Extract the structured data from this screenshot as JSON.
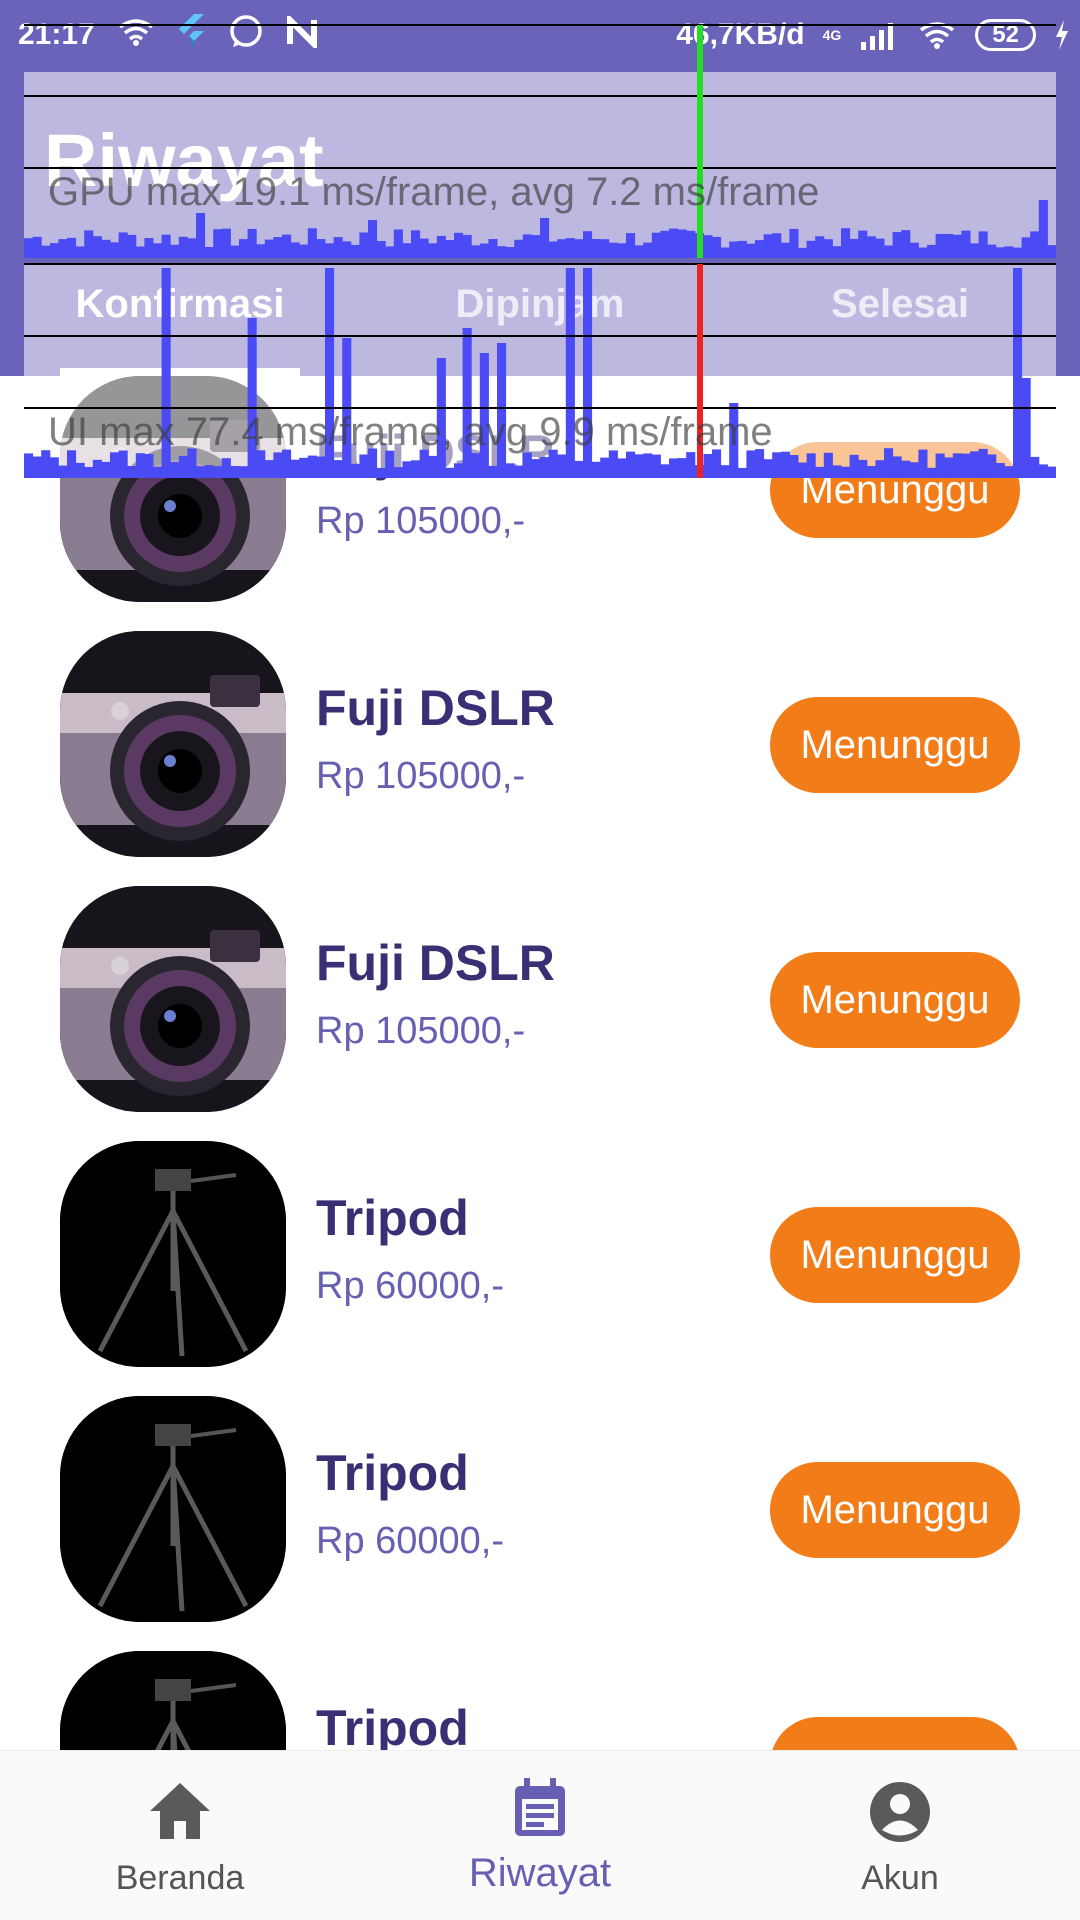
{
  "status_bar": {
    "time": "21:17",
    "network_speed": "46,7KB/d",
    "network_type": "4G",
    "battery": "52",
    "icons": [
      "wifi-icon",
      "flutter-icon",
      "whatsapp-icon",
      "n-app-icon",
      "signal-icon",
      "wifi-icon",
      "battery-icon",
      "charging-icon"
    ]
  },
  "header": {
    "title": "Riwayat",
    "background_color": "#6a63ba"
  },
  "tabs": [
    {
      "label": "Konfirmasi",
      "active": true
    },
    {
      "label": "Dipinjam",
      "active": false
    },
    {
      "label": "Selesai",
      "active": false
    }
  ],
  "performance_overlay": {
    "gpu_text": "GPU  max 19.1 ms/frame, avg 7.2 ms/frame",
    "ui_text": "UI  max 77.4 ms/frame, avg 9.9 ms/frame"
  },
  "items": [
    {
      "name": "Fuji DSLR",
      "price": "Rp 105000,-",
      "status": "Menunggu",
      "image": "camera"
    },
    {
      "name": "Fuji DSLR",
      "price": "Rp 105000,-",
      "status": "Menunggu",
      "image": "camera"
    },
    {
      "name": "Fuji DSLR",
      "price": "Rp 105000,-",
      "status": "Menunggu",
      "image": "camera"
    },
    {
      "name": "Tripod",
      "price": "Rp 60000,-",
      "status": "Menunggu",
      "image": "tripod"
    },
    {
      "name": "Tripod",
      "price": "Rp 60000,-",
      "status": "Menunggu",
      "image": "tripod"
    },
    {
      "name": "Tripod",
      "price": "",
      "status": "",
      "image": "tripod"
    }
  ],
  "colors": {
    "accent": "#6760b2",
    "status_button": "#f27d18",
    "item_title": "#3a2f74"
  },
  "bottom_nav": [
    {
      "label": "Beranda",
      "icon": "home-icon",
      "active": false
    },
    {
      "label": "Riwayat",
      "icon": "calendar-icon",
      "active": true
    },
    {
      "label": "Akun",
      "icon": "account-icon",
      "active": false
    }
  ]
}
